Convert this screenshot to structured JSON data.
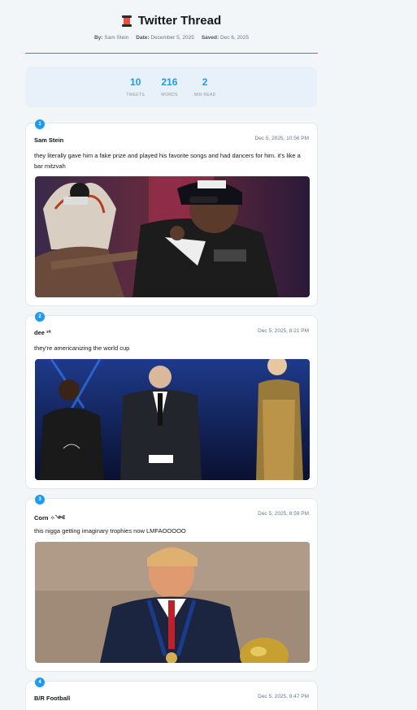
{
  "header": {
    "icon": "spool-of-thread-icon",
    "title": "Twitter Thread",
    "by_label": "By:",
    "by_value": "Sam Stein",
    "date_label": "Date:",
    "date_value": "December 5, 2025",
    "saved_label": "Saved:",
    "saved_value": "Dec 6, 2025"
  },
  "stats": [
    {
      "value": "10",
      "label": "TWEETS"
    },
    {
      "value": "216",
      "label": "WORDS"
    },
    {
      "value": "2",
      "label": "MIN READ"
    }
  ],
  "tweets": [
    {
      "number": "1",
      "author": "Sam Stein",
      "time": "Dec 5, 2025, 10:56 PM",
      "text": "they literally gave him a fake prize and played his favorite songs and had dancers for him. it's like a bar mitzvah",
      "media_alt": "performer in police-style hat and dancer in feathered headdress on stage"
    },
    {
      "number": "2",
      "author": "dee ²⁰",
      "time": "Dec 5, 2025, 8:21 PM",
      "text": "they're americanizing the world cup",
      "media_alt": "three people on a stage with blue lighting"
    },
    {
      "number": "3",
      "author": "Corn ✧༺",
      "time": "Dec 5, 2025, 8:59 PM",
      "text": "this nigga getting imaginary trophies now LMFAOOOOO",
      "media_alt": "man in suit wearing a medal next to a golden trophy"
    },
    {
      "number": "4",
      "author": "B/R Football",
      "time": "Dec 5, 2025, 9:47 PM",
      "text": ""
    }
  ],
  "colors": {
    "accent": "#1d9bf0",
    "divider": "#1da1a0",
    "stats_bg": "#e8f1f9"
  }
}
